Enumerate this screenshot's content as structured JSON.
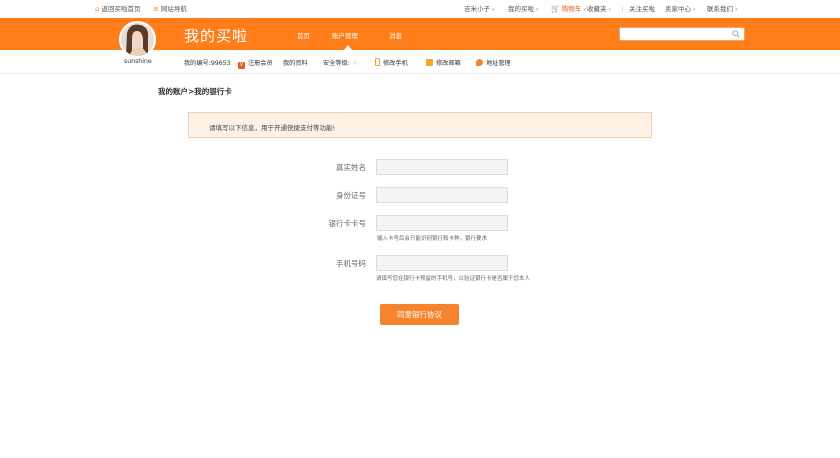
{
  "topbar": {
    "home_link": "返回买啦首页",
    "site_nav": "网站导航",
    "user_name": "吉米小子",
    "my_buy": "我的买啦",
    "cart": "购物车",
    "favorites": "收藏夹",
    "follow": "关注买啦",
    "seller_center": "卖家中心",
    "contact": "联系我们"
  },
  "header": {
    "logo_text": "我的买啦",
    "nav": [
      "首页",
      "账户管理",
      "消息"
    ],
    "active_nav": "账户管理",
    "search": {
      "value": "",
      "placeholder": ""
    }
  },
  "subbar": {
    "username": "sunshine",
    "account_no": "我的编号:99653",
    "member": "注册会员",
    "my_profile": "我的资料",
    "security_level": "安全等级:",
    "edit_phone": "修改手机",
    "edit_email": "修改邮箱",
    "address_mgmt": "地址管理"
  },
  "breadcrumb": "我的账户>我的银行卡",
  "notice": "请填写以下信息，用于开通快捷支付等功能!",
  "form": {
    "real_name_label": "真实姓名",
    "real_name_value": "",
    "id_label": "身份证号",
    "id_value": "",
    "card_label": "银行卡卡号",
    "card_value": "",
    "card_hint": "输入卡号后会只能识别银行和卡种，银行要求",
    "phone_label": "手机号码",
    "phone_value": "",
    "phone_hint": "请填写您在银行卡预留的手机号，以验证银行卡是否属于您本人"
  },
  "submit_label": "同意银行协议",
  "colors": {
    "brand_orange": "#ff7e19",
    "button": "#f5842c",
    "notice_bg": "#fdf0e4"
  }
}
